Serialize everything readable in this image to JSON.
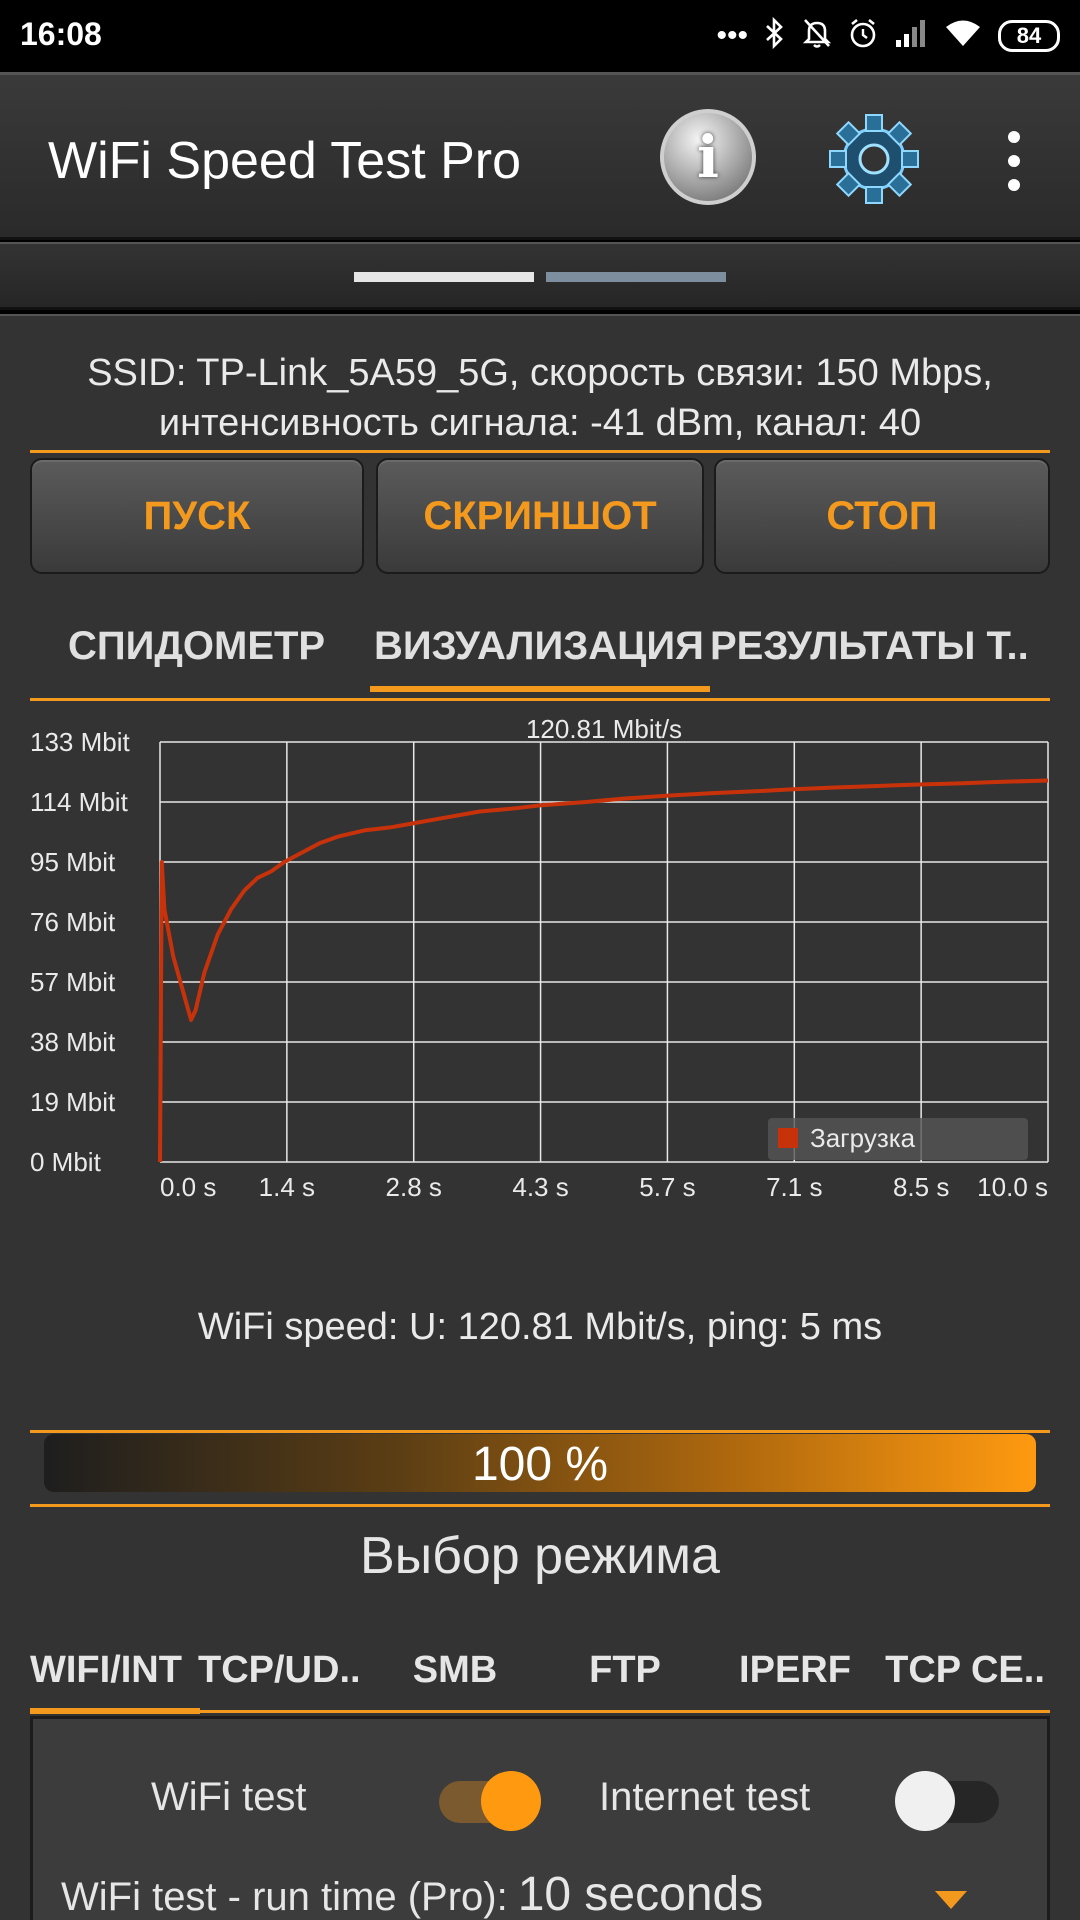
{
  "status_bar": {
    "time": "16:08",
    "icons": [
      "more-dots-icon",
      "bluetooth-icon",
      "bell-off-icon",
      "alarm-icon",
      "signal-icon",
      "wifi-icon"
    ],
    "battery": "84"
  },
  "app_bar": {
    "title": "WiFi Speed Test Pro",
    "info_icon_glyph": "i"
  },
  "connection_info": {
    "line1": "SSID: TP-Link_5A59_5G, скорость связи: 150 Mbps,",
    "line2": "интенсивность сигнала: -41 dBm, канал: 40"
  },
  "buttons": {
    "start": "ПУСК",
    "screenshot": "СКРИНШОТ",
    "stop": "СТОП"
  },
  "view_tabs": [
    {
      "label": "СПИДОМЕТР"
    },
    {
      "label": "ВИЗУАЛИЗАЦИЯ",
      "selected": true
    },
    {
      "label": "РЕЗУЛЬТАТЫ Т.."
    }
  ],
  "chart_data": {
    "type": "line",
    "title": "120.81 Mbit/s",
    "y_ticks": [
      "133 Mbit",
      "114 Mbit",
      "95 Mbit",
      "76 Mbit",
      "57 Mbit",
      "38 Mbit",
      "19 Mbit",
      "0 Mbit"
    ],
    "x_ticks": [
      "0.0 s",
      "1.4 s",
      "2.8 s",
      "4.3 s",
      "5.7 s",
      "7.1 s",
      "8.5 s",
      "10.0 s"
    ],
    "xlim": [
      0,
      10
    ],
    "ylim": [
      0,
      133
    ],
    "grid": true,
    "legend_position": "bottom-right",
    "color": "#c8320a",
    "series": [
      {
        "name": "Загрузка",
        "x": [
          0,
          0.02,
          0.05,
          0.15,
          0.3,
          0.35,
          0.4,
          0.5,
          0.65,
          0.8,
          0.95,
          1.1,
          1.25,
          1.4,
          1.6,
          1.8,
          2.0,
          2.3,
          2.6,
          2.8,
          3.2,
          3.6,
          4.0,
          4.3,
          4.8,
          5.2,
          5.7,
          6.2,
          6.8,
          7.1,
          7.6,
          8.0,
          8.5,
          9.0,
          9.5,
          10.0
        ],
        "y": [
          0,
          95,
          80,
          65,
          50,
          45,
          48,
          60,
          72,
          80,
          86,
          90,
          92,
          95,
          98,
          101,
          103,
          105,
          106,
          107,
          109,
          111,
          112,
          113,
          114,
          115,
          116,
          116.8,
          117.5,
          118,
          118.6,
          119,
          119.5,
          119.9,
          120.4,
          120.81
        ]
      }
    ]
  },
  "speed_summary": "WiFi speed: U: 120.81 Mbit/s, ping: 5 ms",
  "progress": {
    "value": 100,
    "label": "100 %"
  },
  "mode": {
    "title": "Выбор режима",
    "tabs": [
      {
        "label": "WIFI/INT",
        "selected": true
      },
      {
        "label": "TCP/UD.."
      },
      {
        "label": "SMB"
      },
      {
        "label": "FTP"
      },
      {
        "label": "IPERF"
      },
      {
        "label": "TCP CE.."
      }
    ]
  },
  "options": {
    "wifi_test_label": "WiFi test",
    "wifi_test_on": true,
    "internet_test_label": "Internet test",
    "internet_test_on": false,
    "runtime_label": "WiFi test - run time (Pro):",
    "runtime_value": "10 seconds"
  },
  "colors": {
    "accent": "#f39a1e",
    "series": "#c8320a",
    "panel_bg": "#333333"
  }
}
